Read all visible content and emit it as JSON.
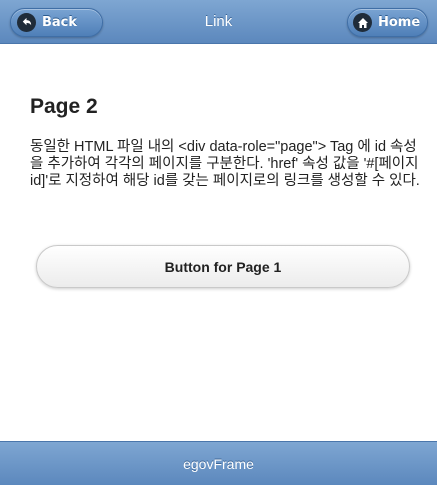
{
  "header": {
    "title": "Link",
    "back_label": "Back",
    "home_label": "Home"
  },
  "icons": {
    "back": "back-arrow-icon",
    "home": "home-icon"
  },
  "content": {
    "title": "Page 2",
    "description": "동일한 HTML 파일 내의 <div data-role=\"page\"> Tag 에 id 속성을 추가하여 각각의 페이지를 구분한다. 'href' 속성 값을 '#[페이지 id]'로 지정하여 해당 id를 갖는 페이지로의 링크를 생성할 수 있다.",
    "button_label": "Button for Page 1"
  },
  "footer": {
    "label": "egovFrame"
  },
  "colors": {
    "bar": "#5c88bd",
    "button": "#4f7fb8"
  }
}
